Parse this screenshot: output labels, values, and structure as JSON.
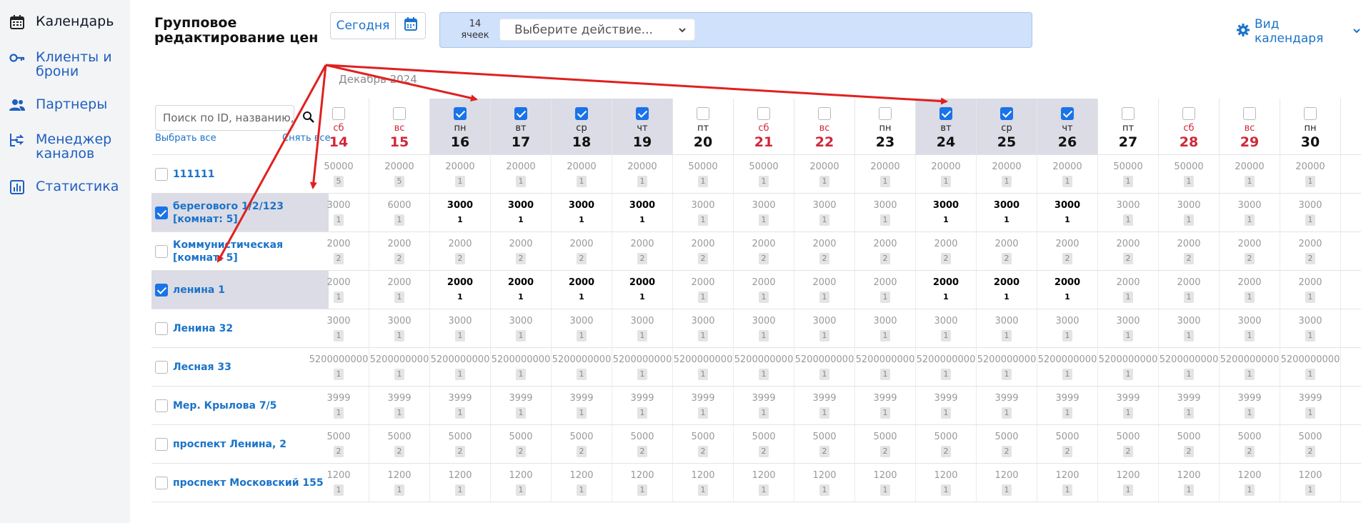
{
  "nav": [
    {
      "label": "Календарь",
      "icon": "calendar-icon",
      "active": true
    },
    {
      "label": "Клиенты и\nброни",
      "icon": "key-icon"
    },
    {
      "label": "Партнеры",
      "icon": "users-icon"
    },
    {
      "label": "Менеджер\nканалов",
      "icon": "channel-manager-icon"
    },
    {
      "label": "Статистика",
      "icon": "chart-icon"
    }
  ],
  "header": {
    "title": "Групповое\nредактирование цен",
    "today_label": "Сегодня",
    "cells_count": "14\nячеек",
    "action_placeholder": "Выберите действие...",
    "view_label": "Вид календаря"
  },
  "month_label": "Декабрь 2024",
  "search": {
    "placeholder": "Поиск по ID, названию, а",
    "select_all": "Выбрать все",
    "deselect_all": "Снять все"
  },
  "days": [
    {
      "dow": "сб",
      "num": "14",
      "weekend": true,
      "checked": false
    },
    {
      "dow": "вс",
      "num": "15",
      "weekend": true,
      "checked": false
    },
    {
      "dow": "пн",
      "num": "16",
      "weekend": false,
      "checked": true
    },
    {
      "dow": "вт",
      "num": "17",
      "weekend": false,
      "checked": true
    },
    {
      "dow": "ср",
      "num": "18",
      "weekend": false,
      "checked": true
    },
    {
      "dow": "чт",
      "num": "19",
      "weekend": false,
      "checked": true
    },
    {
      "dow": "пт",
      "num": "20",
      "weekend": false,
      "checked": false
    },
    {
      "dow": "сб",
      "num": "21",
      "weekend": true,
      "checked": false
    },
    {
      "dow": "вс",
      "num": "22",
      "weekend": true,
      "checked": false
    },
    {
      "dow": "пн",
      "num": "23",
      "weekend": false,
      "checked": false
    },
    {
      "dow": "вт",
      "num": "24",
      "weekend": false,
      "checked": true
    },
    {
      "dow": "ср",
      "num": "25",
      "weekend": false,
      "checked": true
    },
    {
      "dow": "чт",
      "num": "26",
      "weekend": false,
      "checked": true
    },
    {
      "dow": "пт",
      "num": "27",
      "weekend": false,
      "checked": false
    },
    {
      "dow": "сб",
      "num": "28",
      "weekend": true,
      "checked": false
    },
    {
      "dow": "вс",
      "num": "29",
      "weekend": true,
      "checked": false
    },
    {
      "dow": "пн",
      "num": "30",
      "weekend": false,
      "checked": false
    }
  ],
  "rooms": [
    {
      "name": "111111",
      "checked": false,
      "prices": [
        "50000",
        "20000",
        "20000",
        "20000",
        "20000",
        "20000",
        "50000",
        "50000",
        "20000",
        "20000",
        "20000",
        "20000",
        "20000",
        "50000",
        "50000",
        "20000",
        "20000"
      ],
      "avail": [
        "5",
        "5",
        "1",
        "1",
        "1",
        "1",
        "1",
        "1",
        "1",
        "1",
        "1",
        "1",
        "1",
        "1",
        "1",
        "1",
        "1"
      ]
    },
    {
      "name": "берегового 1/2/123\n[комнат: 5]",
      "checked": true,
      "prices": [
        "3000",
        "6000",
        "3000",
        "3000",
        "3000",
        "3000",
        "3000",
        "3000",
        "3000",
        "3000",
        "3000",
        "3000",
        "3000",
        "3000",
        "3000",
        "3000",
        "3000"
      ],
      "avail": [
        "1",
        "1",
        "1",
        "1",
        "1",
        "1",
        "1",
        "1",
        "1",
        "1",
        "1",
        "1",
        "1",
        "1",
        "1",
        "1",
        "1"
      ]
    },
    {
      "name": "Коммунистическая\n[комнат: 5]",
      "checked": false,
      "prices": [
        "2000",
        "2000",
        "2000",
        "2000",
        "2000",
        "2000",
        "2000",
        "2000",
        "2000",
        "2000",
        "2000",
        "2000",
        "2000",
        "2000",
        "2000",
        "2000",
        "2000"
      ],
      "avail": [
        "2",
        "2",
        "2",
        "2",
        "2",
        "2",
        "2",
        "2",
        "2",
        "2",
        "2",
        "2",
        "2",
        "2",
        "2",
        "2",
        "2"
      ]
    },
    {
      "name": "ленина 1",
      "checked": true,
      "prices": [
        "2000",
        "2000",
        "2000",
        "2000",
        "2000",
        "2000",
        "2000",
        "2000",
        "2000",
        "2000",
        "2000",
        "2000",
        "2000",
        "2000",
        "2000",
        "2000",
        "2000"
      ],
      "avail": [
        "1",
        "1",
        "1",
        "1",
        "1",
        "1",
        "1",
        "1",
        "1",
        "1",
        "1",
        "1",
        "1",
        "1",
        "1",
        "1",
        "1"
      ]
    },
    {
      "name": "Ленина 32",
      "checked": false,
      "prices": [
        "3000",
        "3000",
        "3000",
        "3000",
        "3000",
        "3000",
        "3000",
        "3000",
        "3000",
        "3000",
        "3000",
        "3000",
        "3000",
        "3000",
        "3000",
        "3000",
        "3000"
      ],
      "avail": [
        "1",
        "1",
        "1",
        "1",
        "1",
        "1",
        "1",
        "1",
        "1",
        "1",
        "1",
        "1",
        "1",
        "1",
        "1",
        "1",
        "1"
      ]
    },
    {
      "name": "Лесная 33",
      "checked": false,
      "prices": [
        "5200000000",
        "5200000000",
        "5200000000",
        "5200000000",
        "5200000000",
        "5200000000",
        "5200000000",
        "5200000000",
        "5200000000",
        "5200000000",
        "5200000000",
        "5200000000",
        "5200000000",
        "5200000000",
        "5200000000",
        "5200000000",
        "5200000000"
      ],
      "avail": [
        "1",
        "1",
        "1",
        "1",
        "1",
        "1",
        "1",
        "1",
        "1",
        "1",
        "1",
        "1",
        "1",
        "1",
        "1",
        "1",
        "1"
      ]
    },
    {
      "name": "Мер. Крылова 7/5",
      "checked": false,
      "prices": [
        "3999",
        "3999",
        "3999",
        "3999",
        "3999",
        "3999",
        "3999",
        "3999",
        "3999",
        "3999",
        "3999",
        "3999",
        "3999",
        "3999",
        "3999",
        "3999",
        "3999"
      ],
      "avail": [
        "1",
        "1",
        "1",
        "1",
        "1",
        "1",
        "1",
        "1",
        "1",
        "1",
        "1",
        "1",
        "1",
        "1",
        "1",
        "1",
        "1"
      ]
    },
    {
      "name": "проспект Ленина, 2",
      "checked": false,
      "prices": [
        "5000",
        "5000",
        "5000",
        "5000",
        "5000",
        "5000",
        "5000",
        "5000",
        "5000",
        "5000",
        "5000",
        "5000",
        "5000",
        "5000",
        "5000",
        "5000",
        "5000"
      ],
      "avail": [
        "2",
        "2",
        "2",
        "2",
        "2",
        "2",
        "2",
        "2",
        "2",
        "2",
        "2",
        "2",
        "2",
        "2",
        "2",
        "2",
        "2"
      ]
    },
    {
      "name": "проспект Московский 155",
      "checked": false,
      "prices": [
        "1200",
        "1200",
        "1200",
        "1200",
        "1200",
        "1200",
        "1200",
        "1200",
        "1200",
        "1200",
        "1200",
        "1200",
        "1200",
        "1200",
        "1200",
        "1200",
        "1200"
      ],
      "avail": [
        "1",
        "1",
        "1",
        "1",
        "1",
        "1",
        "1",
        "1",
        "1",
        "1",
        "1",
        "1",
        "1",
        "1",
        "1",
        "1",
        "1"
      ]
    }
  ],
  "colors": {
    "accent": "#1a73c9",
    "weekend": "#d0283a",
    "selected_bg": "#dcdce6",
    "arrow": "#e02020"
  }
}
